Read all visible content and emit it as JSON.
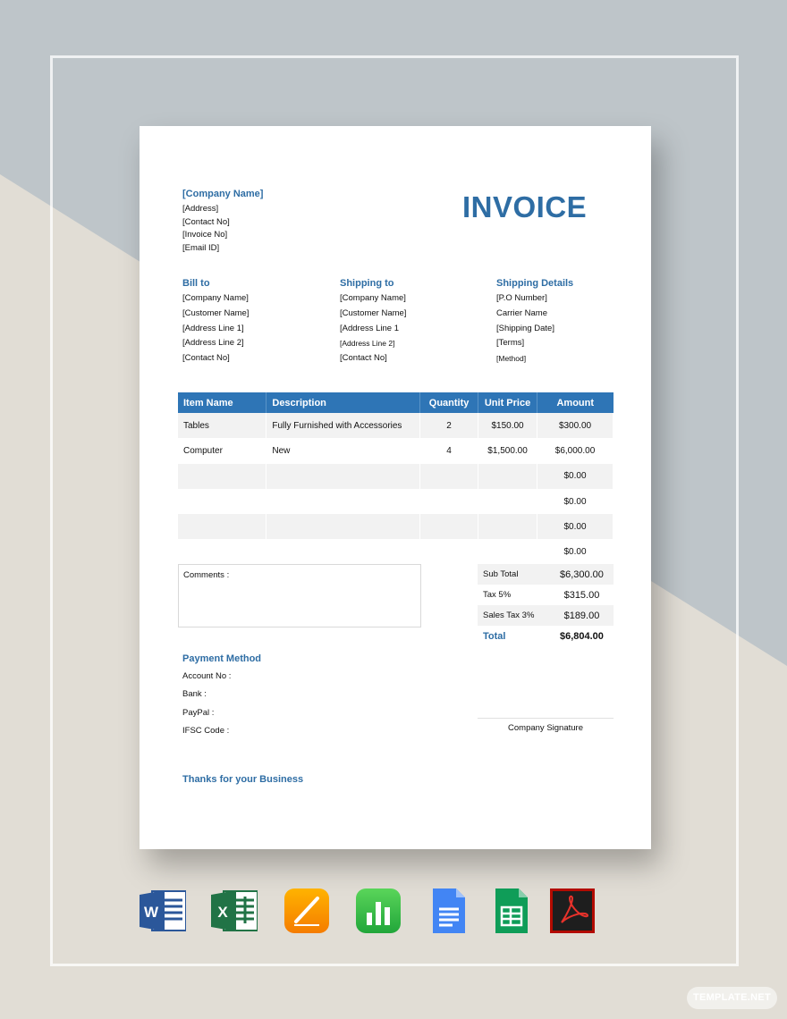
{
  "header": {
    "company_name": "[Company Name]",
    "address_lines": [
      "[Address]",
      "[Contact No]",
      "[Invoice No]",
      "[Email ID]"
    ],
    "title": "INVOICE"
  },
  "bill_to": {
    "heading": "Bill to",
    "lines": [
      "[Company Name]",
      "[Customer Name]",
      "[Address Line 1]",
      "[Address Line 2]",
      "[Contact No]"
    ]
  },
  "shipping_to": {
    "heading": "Shipping to",
    "lines": [
      "[Company Name]",
      "[Customer Name]",
      "[Address Line 1",
      "[Address Line 2]",
      "[Contact No]"
    ]
  },
  "shipping_details": {
    "heading": "Shipping Details",
    "lines": [
      "[P.O Number]",
      "Carrier Name",
      "[Shipping Date]",
      "[Terms]",
      "[Method]"
    ]
  },
  "items_table": {
    "columns": [
      "Item Name",
      "Description",
      "Quantity",
      "Unit Price",
      "Amount"
    ],
    "rows": [
      [
        "Tables",
        "Fully Furnished with Accessories",
        "2",
        "$150.00",
        "$300.00"
      ],
      [
        "Computer",
        "New",
        "4",
        "$1,500.00",
        "$6,000.00"
      ],
      [
        "",
        "",
        "",
        "",
        "$0.00"
      ],
      [
        "",
        "",
        "",
        "",
        "$0.00"
      ],
      [
        "",
        "",
        "",
        "",
        "$0.00"
      ],
      [
        "",
        "",
        "",
        "",
        "$0.00"
      ]
    ]
  },
  "comments_label": "Comments :",
  "totals": [
    {
      "label": "Sub Total",
      "value": "$6,300.00"
    },
    {
      "label": "Tax 5%",
      "value": "$315.00"
    },
    {
      "label": "Sales Tax 3%",
      "value": "$189.00"
    },
    {
      "label": "Total",
      "value": "$6,804.00"
    }
  ],
  "payment": {
    "heading": "Payment Method",
    "lines": [
      "Account No :",
      "Bank :",
      "PayPal :",
      "IFSC Code :"
    ]
  },
  "signature_label": "Company Signature",
  "thanks": "Thanks for your Business",
  "format_icons": [
    "word-icon",
    "excel-icon",
    "pages-icon",
    "numbers-icon",
    "google-docs-icon",
    "google-sheets-icon",
    "pdf-icon"
  ],
  "brand_badge": "TEMPLATE.NET",
  "colors": {
    "accent_blue": "#2e6da4",
    "table_header": "#2e75b6",
    "bg_top": "#bec5c9",
    "bg_bottom": "#e1ddd5"
  }
}
